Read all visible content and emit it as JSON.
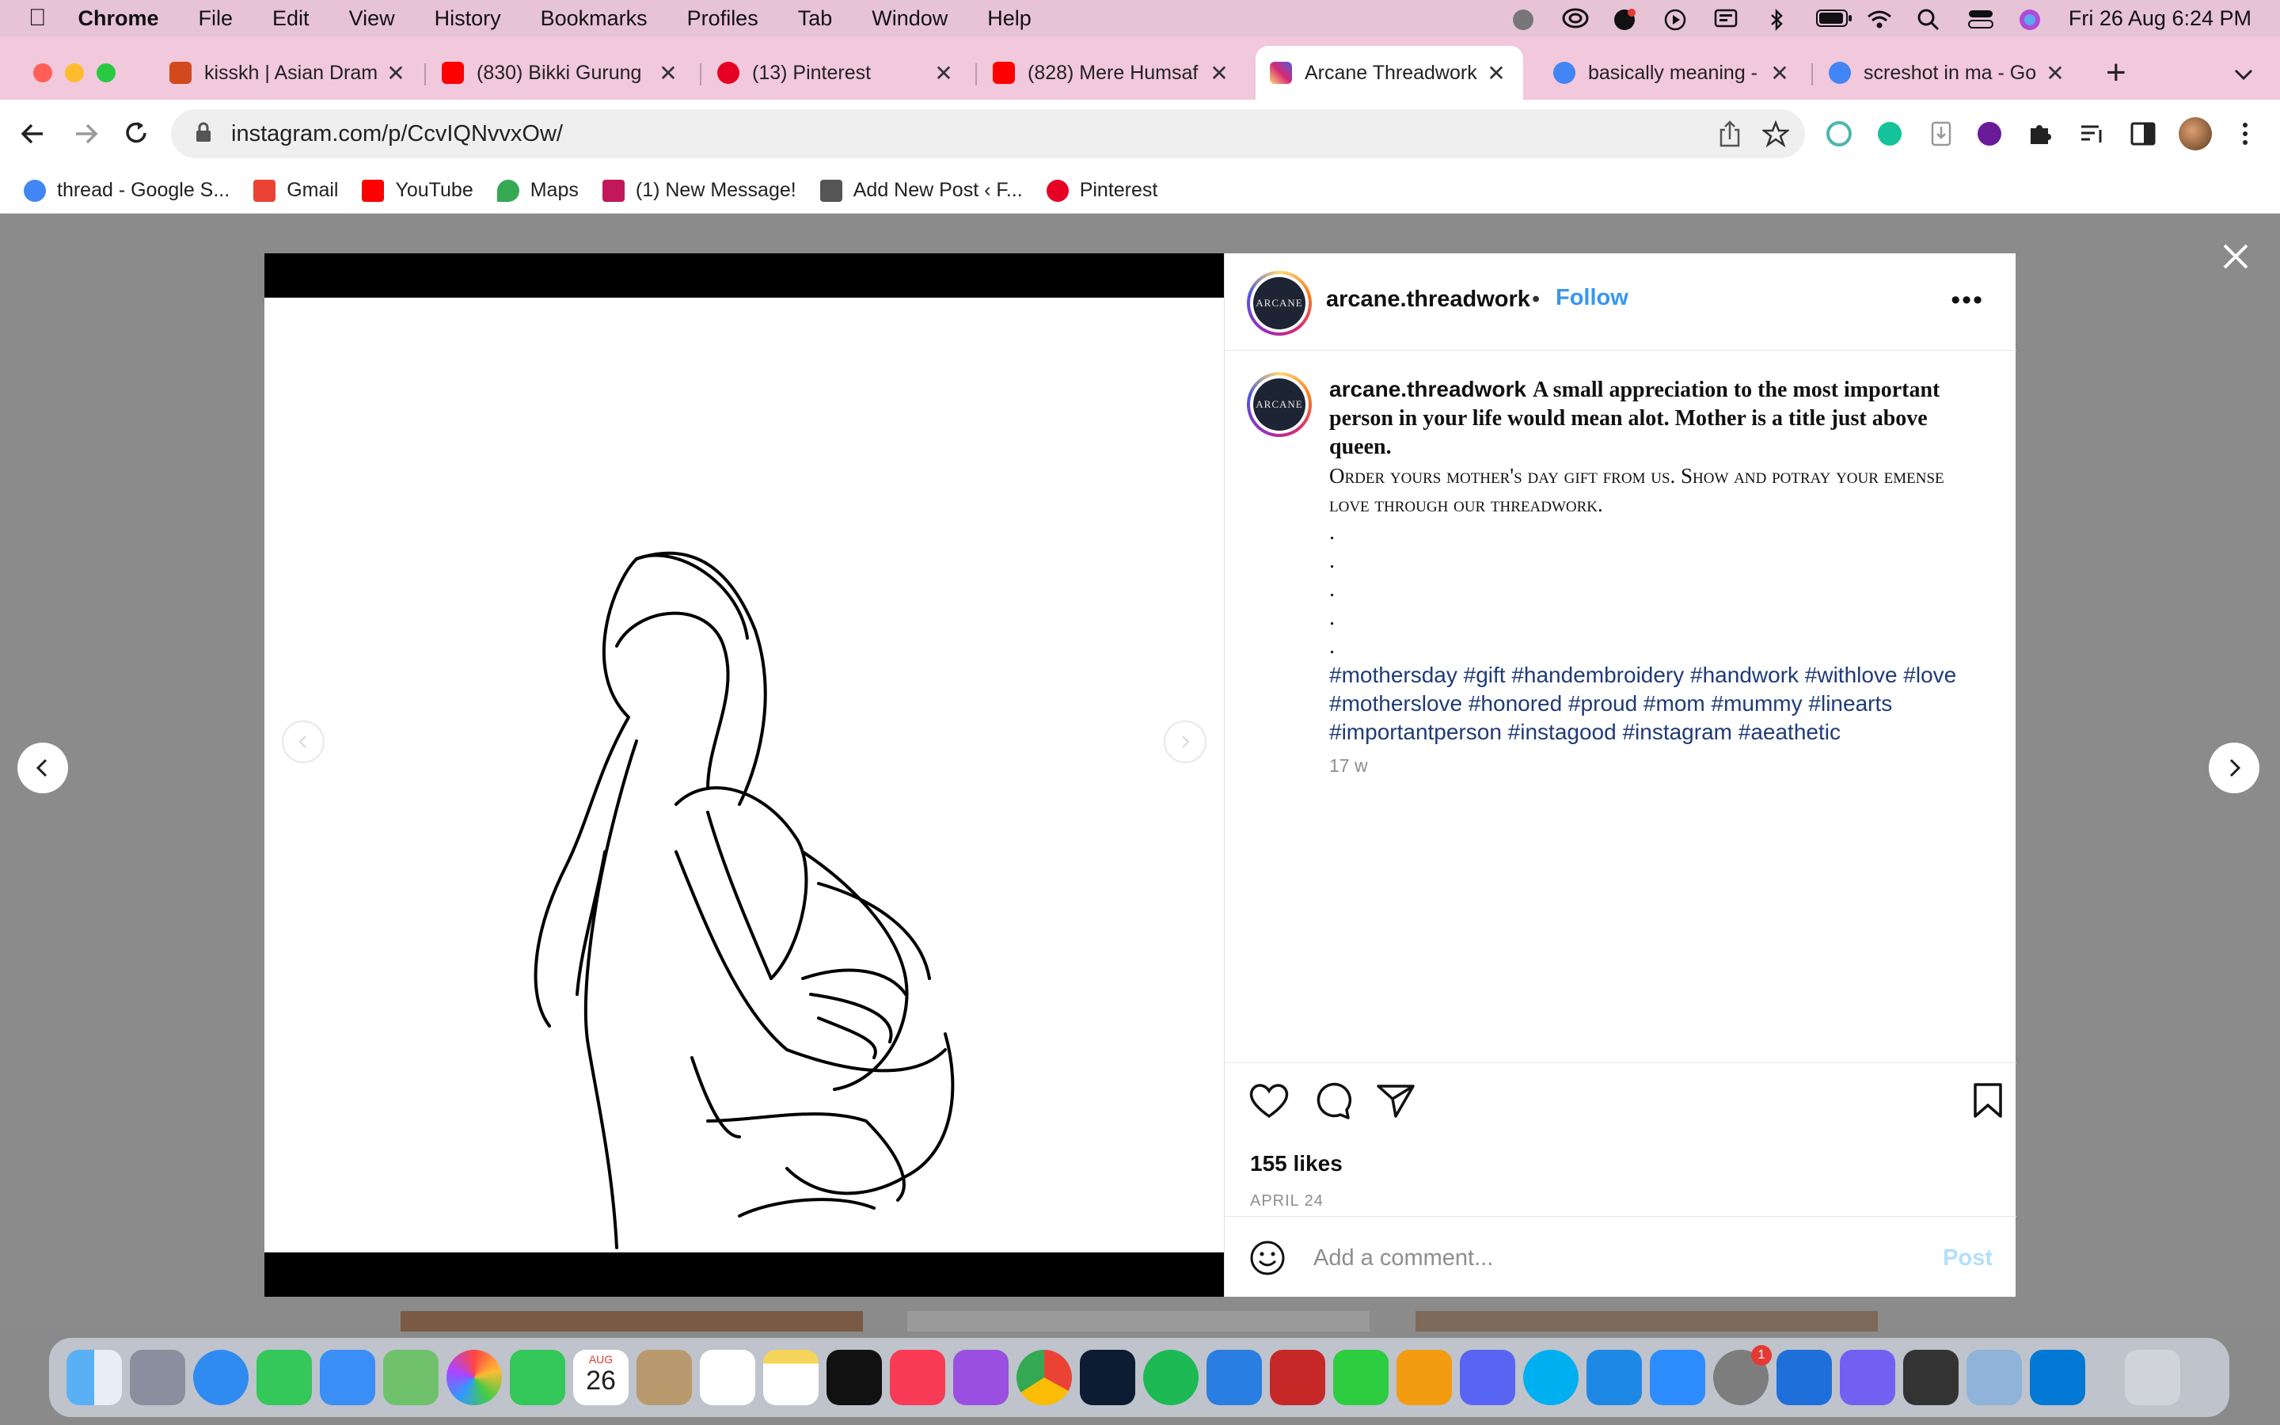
{
  "menubar": {
    "app": "Chrome",
    "items": [
      "File",
      "Edit",
      "View",
      "History",
      "Bookmarks",
      "Profiles",
      "Tab",
      "Window",
      "Help"
    ],
    "clock": "Fri 26 Aug  6:24 PM"
  },
  "tabs": [
    {
      "title": "kisskh | Asian Dram",
      "color": "#d04a1e"
    },
    {
      "title": "(830) Bikki Gurung",
      "color": "#ff0000"
    },
    {
      "title": "(13) Pinterest",
      "color": "#e60023"
    },
    {
      "title": "(828) Mere Humsaf",
      "color": "#ff0000"
    },
    {
      "title": "Arcane Threadwork",
      "color": "#d62976"
    },
    {
      "title": "basically meaning -",
      "color": "#4285f4"
    },
    {
      "title": "screshot in ma - Go",
      "color": "#4285f4"
    }
  ],
  "address": {
    "url": "instagram.com/p/CcvIQNvvxOw/"
  },
  "bookmarks": [
    {
      "label": "thread - Google S...",
      "color": "#4285f4"
    },
    {
      "label": "Gmail",
      "color": "#ea4335"
    },
    {
      "label": "YouTube",
      "color": "#ff0000"
    },
    {
      "label": "Maps",
      "color": "#34a853"
    },
    {
      "label": "(1) New Message!",
      "color": "#c2185b"
    },
    {
      "label": "Add New Post ‹ F...",
      "color": "#555555"
    },
    {
      "label": "Pinterest",
      "color": "#e60023"
    }
  ],
  "post": {
    "username": "arcane.threadwork",
    "separator": "•",
    "follow_label": "Follow",
    "more_label": "•••",
    "avatar_text": "ARCANE",
    "caption_bold": "A small appreciation to the most important person in your life would mean alot. Mother is a title just above queen.",
    "caption_smallcaps": "Order yours mother's day gift from us. Show and potray your emense love through our threadwork.",
    "dots": [
      ".",
      ".",
      ".",
      ".",
      "."
    ],
    "hashtags": "#mothersday #gift #handembroidery #handwork #withlove #love #motherslove #honored #proud #mom #mummy #linearts #importantperson #instagood #instagram #aeathetic",
    "time": "17 w",
    "likes": "155 likes",
    "date": "APRIL 24",
    "comment_placeholder": "Add a comment...",
    "post_label": "Post"
  },
  "dock": {
    "calendar_month": "AUG",
    "calendar_day": "26",
    "badge": "1"
  },
  "colors": {
    "accent": "#3897f0",
    "hashtag": "#1f3a7a",
    "tabstrip": "#f2c8dc",
    "menubar": "#e7c3d6"
  }
}
